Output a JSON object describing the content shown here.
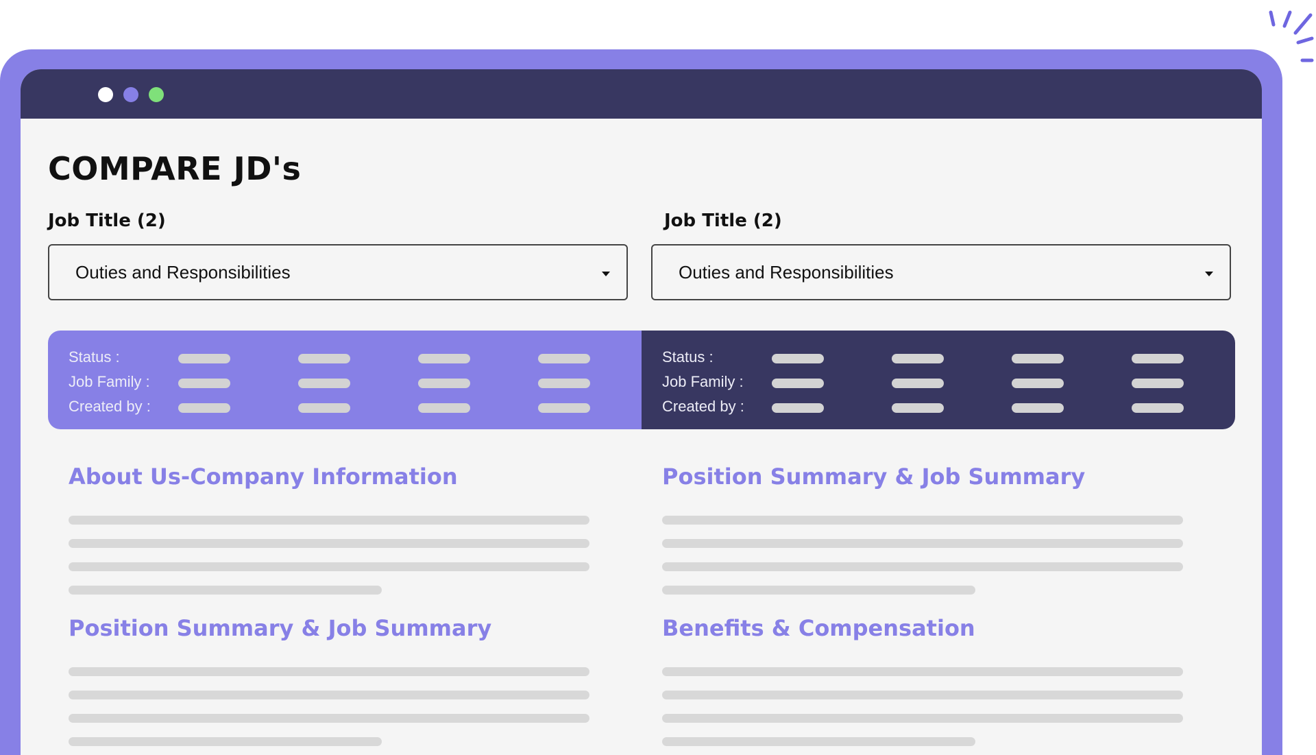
{
  "window": {
    "dots": [
      "white",
      "purple",
      "green"
    ]
  },
  "page": {
    "title": "COMPARE JD's"
  },
  "left": {
    "label": "Job Title (2)",
    "select_value": "Outies and Responsibilities",
    "meta_labels": [
      "Status :",
      "Job Family :",
      "Created by :"
    ],
    "sections": [
      {
        "title": "About Us-Company Information"
      },
      {
        "title": "Position Summary & Job Summary"
      }
    ]
  },
  "right": {
    "label": "Job Title (2)",
    "select_value": "Outies and Responsibilities",
    "meta_labels": [
      "Status :",
      "Job Family :",
      "Created by :"
    ],
    "sections": [
      {
        "title": "Position Summary & Job Summary"
      },
      {
        "title": "Benefits & Compensation"
      }
    ]
  },
  "colors": {
    "accent": "#8780E6",
    "dark": "#383761",
    "background": "#F5F5F5",
    "placeholder": "#D8D8D8"
  },
  "icons": [
    "chevron-down-icon",
    "sparkle-decoration-icon"
  ]
}
